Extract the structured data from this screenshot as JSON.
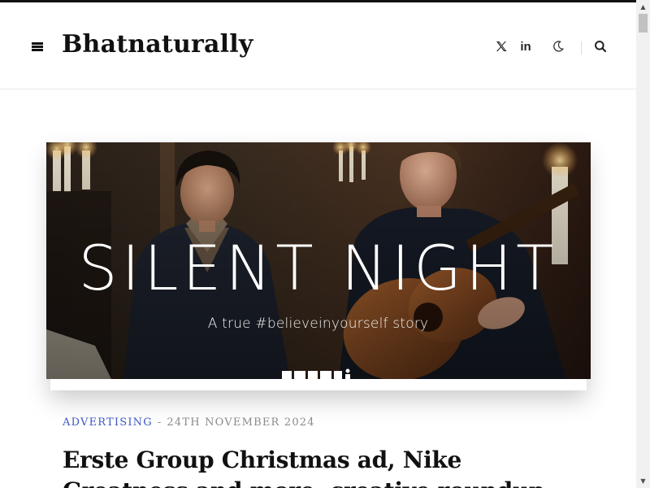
{
  "header": {
    "site_title": "Bhatnaturally",
    "icons": {
      "menu": "menu-icon",
      "x": "x-icon",
      "linkedin": "linkedin-icon",
      "dark_mode": "moon-icon",
      "search": "search-icon"
    },
    "linkedin_label": "in"
  },
  "hero": {
    "title": "SILENT NIGHT",
    "subtitle": "A true #believeinyourself story"
  },
  "post": {
    "category": "ADVERTISING",
    "separator": "-",
    "date": "24TH NOVEMBER 2024",
    "title": "Erste Group Christmas ad, Nike Greatness and more, creative roundup"
  },
  "colors": {
    "accent": "#3b57c4",
    "text": "#111111",
    "muted": "#8a8a8a"
  }
}
